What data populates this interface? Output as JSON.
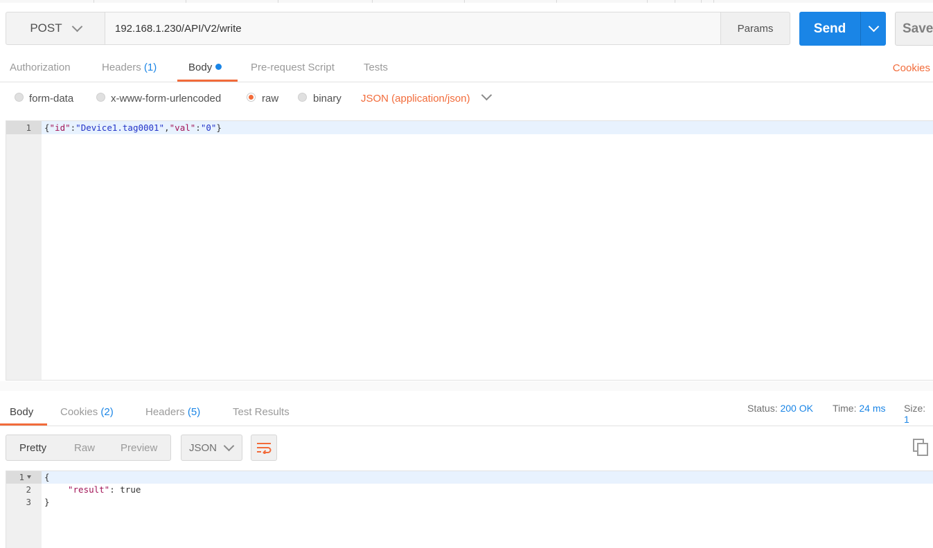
{
  "request": {
    "method": "POST",
    "url": "192.168.1.230/API/V2/write",
    "params_label": "Params",
    "send_label": "Send",
    "save_label": "Save"
  },
  "request_tabs": {
    "authorization": "Authorization",
    "headers": "Headers",
    "headers_count": "(1)",
    "body": "Body",
    "prerequest": "Pre-request Script",
    "tests": "Tests",
    "cookies": "Cookies"
  },
  "body_types": {
    "form_data": "form-data",
    "urlencoded": "x-www-form-urlencoded",
    "raw": "raw",
    "binary": "binary",
    "selected": "raw",
    "content_type": "JSON (application/json)"
  },
  "request_body": {
    "line_number": "1",
    "open": "{",
    "key1": "\"id\"",
    "colon1": ":",
    "val1": "\"Device1.tag0001\"",
    "comma": ",",
    "key2": "\"val\"",
    "colon2": ":",
    "val2": "\"0\"",
    "close": "}"
  },
  "response_tabs": {
    "body": "Body",
    "cookies": "Cookies",
    "cookies_count": "(2)",
    "headers": "Headers",
    "headers_count": "(5)",
    "test_results": "Test Results"
  },
  "response_meta": {
    "status_label": "Status:",
    "status_value": "200 OK",
    "time_label": "Time:",
    "time_value": "24 ms",
    "size_label": "Size:",
    "size_value": "1"
  },
  "view_modes": {
    "pretty": "Pretty",
    "raw": "Raw",
    "preview": "Preview",
    "format": "JSON"
  },
  "response_body": {
    "ln1": "1",
    "ln2": "2",
    "ln3": "3",
    "open": "{",
    "key": "\"result\"",
    "sep": ": ",
    "value": "true",
    "close": "}"
  },
  "colors": {
    "accent": "#f26b3a",
    "primary": "#1a85e6"
  }
}
